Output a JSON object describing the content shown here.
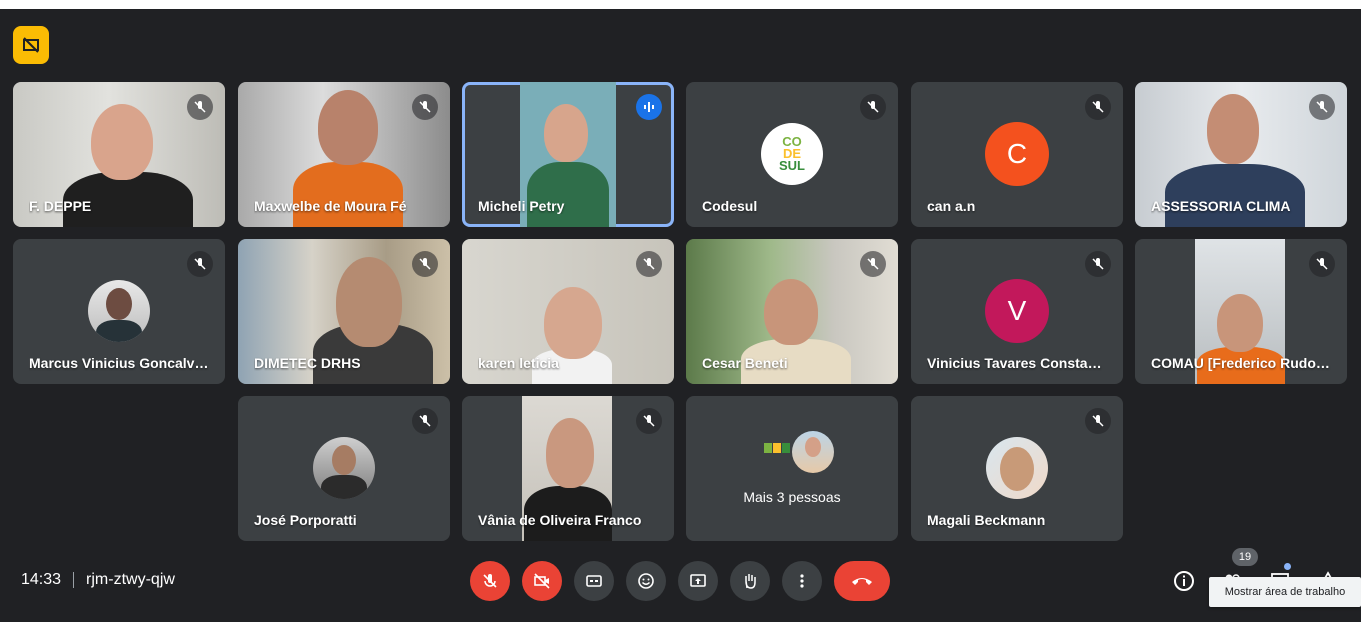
{
  "meeting": {
    "time": "14:33",
    "code": "rjm-ztwy-qjw"
  },
  "participants": [
    {
      "name": "F. DEPPE"
    },
    {
      "name": "Maxwelbe de Moura Fé"
    },
    {
      "name": "Micheli Petry"
    },
    {
      "name": "Codesul"
    },
    {
      "name": "can a.n",
      "initial": "C"
    },
    {
      "name": "ASSESSORIA CLIMA"
    },
    {
      "name": "Marcus Vinicius Goncalve…"
    },
    {
      "name": "DIMETEC DRHS"
    },
    {
      "name": "karen leticia"
    },
    {
      "name": "Cesar Beneti"
    },
    {
      "name": "Vinicius Tavares Constante",
      "initial": "V"
    },
    {
      "name": "COMAU [Frederico Rudor…"
    },
    {
      "name": "José Porporatti"
    },
    {
      "name": "Vânia de Oliveira Franco"
    },
    {
      "name": "Mais 3 pessoas"
    },
    {
      "name": "Magali Beckmann"
    }
  ],
  "codesul_logo": {
    "line1": "CO",
    "line2": "DE",
    "line3": "SUL"
  },
  "participant_count": "19",
  "tooltip": "Mostrar área de trabalho",
  "colors": {
    "accent": "#8ab4f8",
    "danger": "#ea4335",
    "avatar_c": "#f4511e",
    "avatar_v": "#c2185b",
    "badge": "#fbbc04"
  }
}
